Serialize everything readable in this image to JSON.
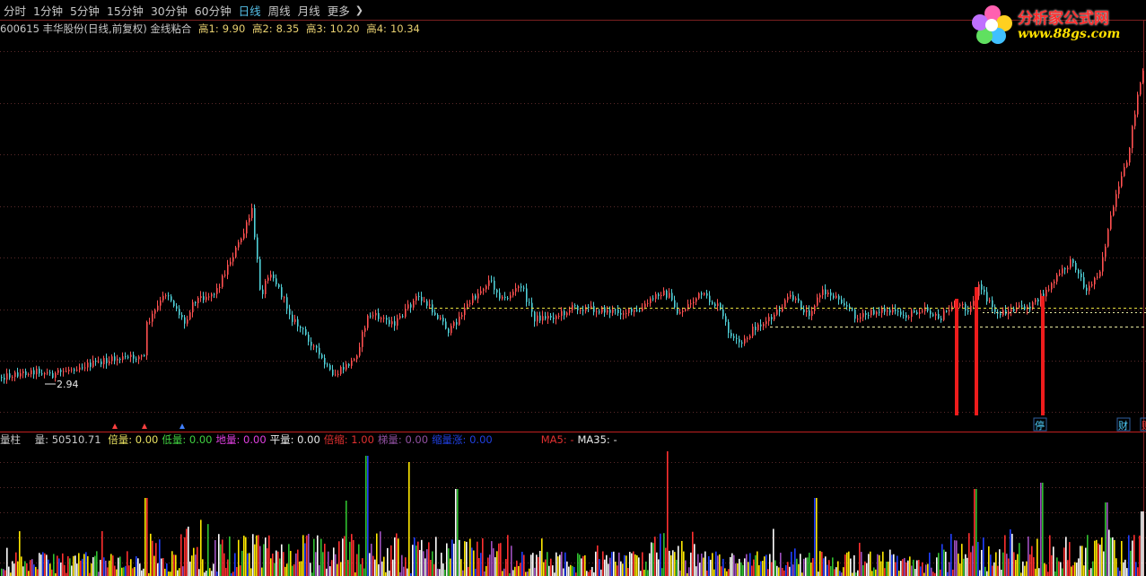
{
  "tabs": {
    "items": [
      "分时",
      "1分钟",
      "5分钟",
      "15分钟",
      "30分钟",
      "60分钟",
      "日线",
      "周线",
      "月线",
      "更多"
    ],
    "active": "日线"
  },
  "info": {
    "stock": "600615 丰华股份(日线,前复权) 金线粘合",
    "h1_label": "高1:",
    "h1": "9.90",
    "h2_label": "高2:",
    "h2": "8.35",
    "h3_label": "高3:",
    "h3": "10.20",
    "h4_label": "高4:",
    "h4": "10.34"
  },
  "logo": {
    "name": "分析家公式网",
    "url": "www.88gs.com"
  },
  "price_panel": {
    "low_marker": "2.94",
    "markers": [
      "停",
      "财",
      "财"
    ]
  },
  "volume_panel": {
    "title": "量柱",
    "vol_label": "量:",
    "vol": "50510.71",
    "items": [
      {
        "label": "倍量:",
        "value": "0.00",
        "color": "#e8e060"
      },
      {
        "label": "低量:",
        "value": "0.00",
        "color": "#40d040"
      },
      {
        "label": "地量:",
        "value": "0.00",
        "color": "#e040e0"
      },
      {
        "label": "平量:",
        "value": "0.00",
        "color": "#e8e8e8"
      },
      {
        "label": "倍缩:",
        "value": "1.00",
        "color": "#e03030"
      },
      {
        "label": "梯量:",
        "value": "0.00",
        "color": "#9050a0"
      },
      {
        "label": "缩量涨:",
        "value": "0.00",
        "color": "#2040e0"
      }
    ],
    "ma5_label": "MA5:",
    "ma5": "-",
    "ma35_label": "MA35:",
    "ma35": "-"
  },
  "colors": {
    "up": "#ff5050",
    "down": "#50d0d8",
    "ref_line": "#e8e040",
    "signal": "#ee1c1c",
    "grid": "#5a2a2a"
  }
}
